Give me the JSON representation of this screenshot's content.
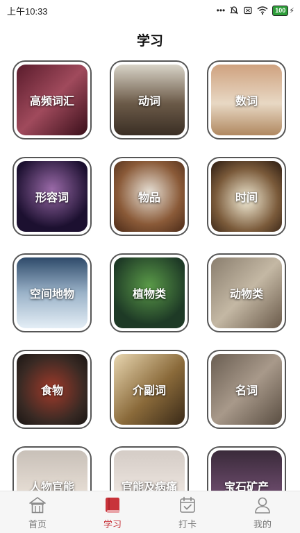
{
  "status_bar": {
    "time": "上午10:33",
    "dots": "•••",
    "battery": "100"
  },
  "page": {
    "title": "学习"
  },
  "tiles": [
    {
      "label": "高频词汇"
    },
    {
      "label": "动词"
    },
    {
      "label": "数词"
    },
    {
      "label": "形容词"
    },
    {
      "label": "物品"
    },
    {
      "label": "时间"
    },
    {
      "label": "空间地物"
    },
    {
      "label": "植物类"
    },
    {
      "label": "动物类"
    },
    {
      "label": "食物"
    },
    {
      "label": "介副词"
    },
    {
      "label": "名词"
    },
    {
      "label": "人物官能"
    },
    {
      "label": "官能及病痛"
    },
    {
      "label": "宝石矿产"
    }
  ],
  "tab_bar": {
    "tabs": [
      {
        "label": "首页",
        "icon": "home-icon"
      },
      {
        "label": "学习",
        "icon": "book-icon"
      },
      {
        "label": "打卡",
        "icon": "calendar-check-icon"
      },
      {
        "label": "我的",
        "icon": "user-icon"
      }
    ],
    "active_color": "#c8333a",
    "inactive_color": "#777777"
  }
}
